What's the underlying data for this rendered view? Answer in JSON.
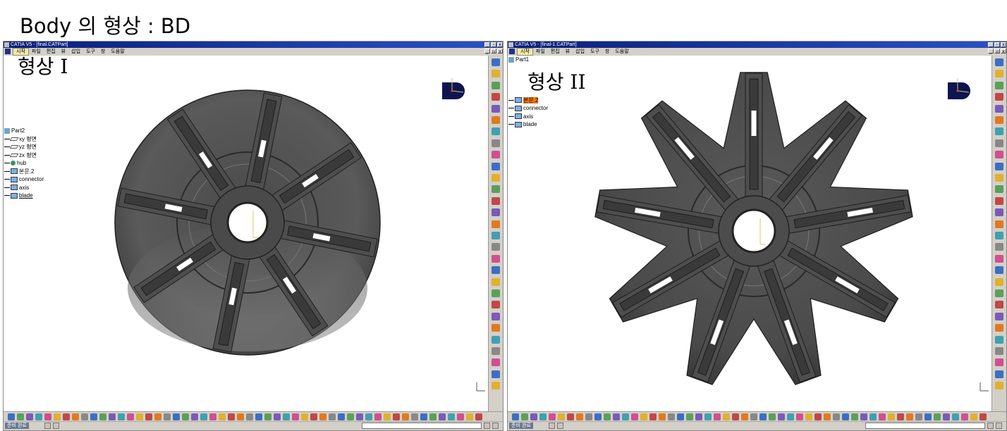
{
  "slide": {
    "title": "Body 의 형상 : BD"
  },
  "windows": [
    {
      "title": "CATIA V5 - [final.CATPart]",
      "menu": [
        "시작",
        "파일",
        "편집",
        "뷰",
        "삽입",
        "도구",
        "창",
        "도움말"
      ],
      "shape_label": "형상 I",
      "tree": {
        "root": "Part2",
        "items": [
          "xy 평면",
          "yz 평면",
          "zx 평면",
          "hub",
          "본문.2",
          "connector",
          "axis",
          "blade"
        ]
      },
      "status": "준비 완료"
    },
    {
      "title": "CATIA V5 - [final-1.CATPart]",
      "menu": [
        "시작",
        "파일",
        "편집",
        "뷰",
        "삽입",
        "도구",
        "창",
        "도움말"
      ],
      "shape_label": "형상 II",
      "tree": {
        "root": "Part1",
        "items": [
          "본문.2",
          "connector",
          "axis",
          "blade"
        ]
      },
      "status": "준비 완료"
    }
  ],
  "colors": {
    "title_bar": "#0a1f7a",
    "chrome": "#d4d0c8",
    "model_dark": "#3c3c3c",
    "model_face": "#6a6a6a",
    "slot_white": "#ffffff",
    "selected": "#f07a10"
  },
  "icons": [
    "compass-icon",
    "axis-triad-icon",
    "tree-icon",
    "window-minimize-icon",
    "window-maximize-icon",
    "window-close-icon"
  ]
}
